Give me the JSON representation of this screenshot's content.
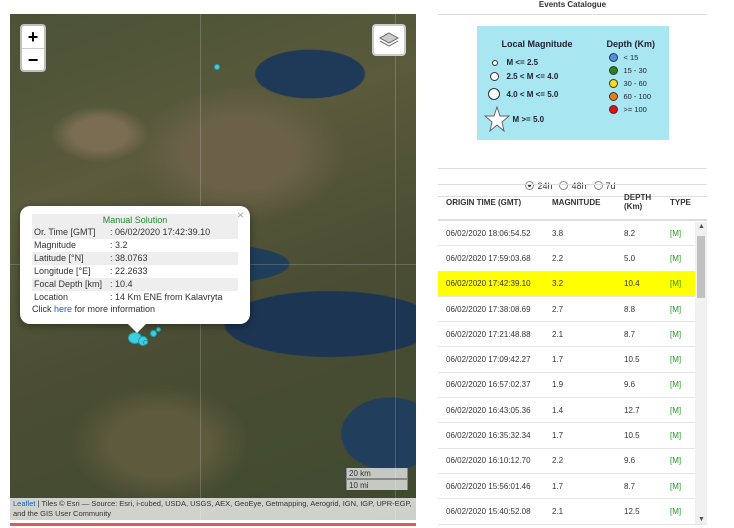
{
  "map": {
    "zoom_in": "+",
    "zoom_out": "−",
    "popup": {
      "title": "Manual Solution",
      "close": "×",
      "rows": [
        {
          "key": "Or. Time [GMT]",
          "value": ": 06/02/2020 17:42:39.10"
        },
        {
          "key": "Magnitude",
          "value": ": 3.2"
        },
        {
          "key": "Latitude [°N]",
          "value": ": 38.0763"
        },
        {
          "key": "Longitude [°E]",
          "value": ": 22.2633"
        },
        {
          "key": "Focal Depth [km]",
          "value": ": 10.4"
        },
        {
          "key": "Location",
          "value": ": 14 Km ENE from Kalavryta"
        }
      ],
      "more_pre": "Click ",
      "more_link": "here",
      "more_post": " for more information"
    },
    "scale_km": "20 km",
    "scale_mi": "10 mi",
    "attribution_link": "Leaflet",
    "attribution_text": " | Tiles © Esri — Source: Esri, i-cubed, USDA, USGS, AEX, GeoEye, Getmapping, Aerogrid, IGN, IGP, UPR-EGP, and the GIS User Community"
  },
  "panel": {
    "title": "Events Catalogue",
    "legend": {
      "magnitude_title": "Local Magnitude",
      "depth_title": "Depth (Km)",
      "magnitudes": [
        "M <= 2.5",
        "2.5 < M <= 4.0",
        "4.0 < M <= 5.0",
        "M >= 5.0"
      ],
      "depths": [
        {
          "label": "< 15",
          "color": "#4f8fe8"
        },
        {
          "label": "15 - 30",
          "color": "#1e8a1e"
        },
        {
          "label": "30 - 60",
          "color": "#f0e020"
        },
        {
          "label": "60 - 100",
          "color": "#f07a10"
        },
        {
          "label": ">= 100",
          "color": "#e01010"
        }
      ]
    },
    "ranges": [
      "24h",
      "48h",
      "7d"
    ],
    "columns": [
      "ORIGIN TIME (GMT)",
      "MAGNITUDE",
      "DEPTH (Km)",
      "TYPE"
    ],
    "events": [
      {
        "time": "06/02/2020 18:06:54.52",
        "mag": "3.8",
        "depth": "8.2",
        "type": "[M]"
      },
      {
        "time": "06/02/2020 17:59:03.68",
        "mag": "2.2",
        "depth": "5.0",
        "type": "[M]"
      },
      {
        "time": "06/02/2020 17:42:39.10",
        "mag": "3.2",
        "depth": "10.4",
        "type": "[M]"
      },
      {
        "time": "06/02/2020 17:38:08.69",
        "mag": "2.7",
        "depth": "8.8",
        "type": "[M]"
      },
      {
        "time": "06/02/2020 17:21:48.88",
        "mag": "2.1",
        "depth": "8.7",
        "type": "[M]"
      },
      {
        "time": "06/02/2020 17:09:42.27",
        "mag": "1.7",
        "depth": "10.5",
        "type": "[M]"
      },
      {
        "time": "06/02/2020 16:57:02.37",
        "mag": "1.9",
        "depth": "9.6",
        "type": "[M]"
      },
      {
        "time": "06/02/2020 16:43:05.36",
        "mag": "1.4",
        "depth": "12.7",
        "type": "[M]"
      },
      {
        "time": "06/02/2020 16:35:32.34",
        "mag": "1.7",
        "depth": "10.5",
        "type": "[M]"
      },
      {
        "time": "06/02/2020 16:10:12.70",
        "mag": "2.2",
        "depth": "9.6",
        "type": "[M]"
      },
      {
        "time": "06/02/2020 15:56:01.46",
        "mag": "1.7",
        "depth": "8.7",
        "type": "[M]"
      },
      {
        "time": "06/02/2020 15:40:52.08",
        "mag": "2.1",
        "depth": "12.5",
        "type": "[M]"
      }
    ]
  }
}
